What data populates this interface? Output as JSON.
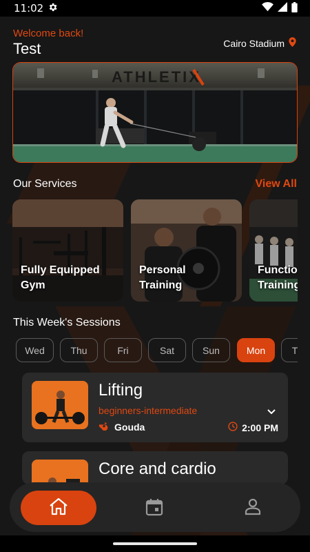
{
  "status_bar": {
    "time": "11:02",
    "icons": [
      "settings-gear-icon",
      "wifi-icon",
      "cell-signal-icon",
      "battery-icon"
    ]
  },
  "header": {
    "welcome": "Welcome back!",
    "username": "Test",
    "location": "Cairo Stadium",
    "location_icon": "location-pin-icon"
  },
  "hero": {
    "sign_text": "ATHLETIX"
  },
  "services": {
    "title": "Our Services",
    "view_all": "View All",
    "items": [
      {
        "label": "Fully Equipped\nGym"
      },
      {
        "label": "Personal\nTraining"
      },
      {
        "label": "Functional\nTraining"
      }
    ]
  },
  "sessions": {
    "title": "This Week's Sessions",
    "days": [
      "Wed",
      "Thu",
      "Fri",
      "Sat",
      "Sun",
      "Mon",
      "Tue"
    ],
    "selected_day": "Mon",
    "items": [
      {
        "title": "Lifting",
        "level": "beginners-intermediate",
        "coach": "Gouda",
        "time": "2:00 PM"
      },
      {
        "title": "Core and cardio"
      }
    ]
  },
  "nav": {
    "items": [
      "home-icon",
      "calendar-icon",
      "profile-icon"
    ],
    "active": "home-icon"
  },
  "colors": {
    "accent": "#d9430f",
    "background": "#171717",
    "card": "#2a2a2a",
    "nav": "#252525"
  }
}
